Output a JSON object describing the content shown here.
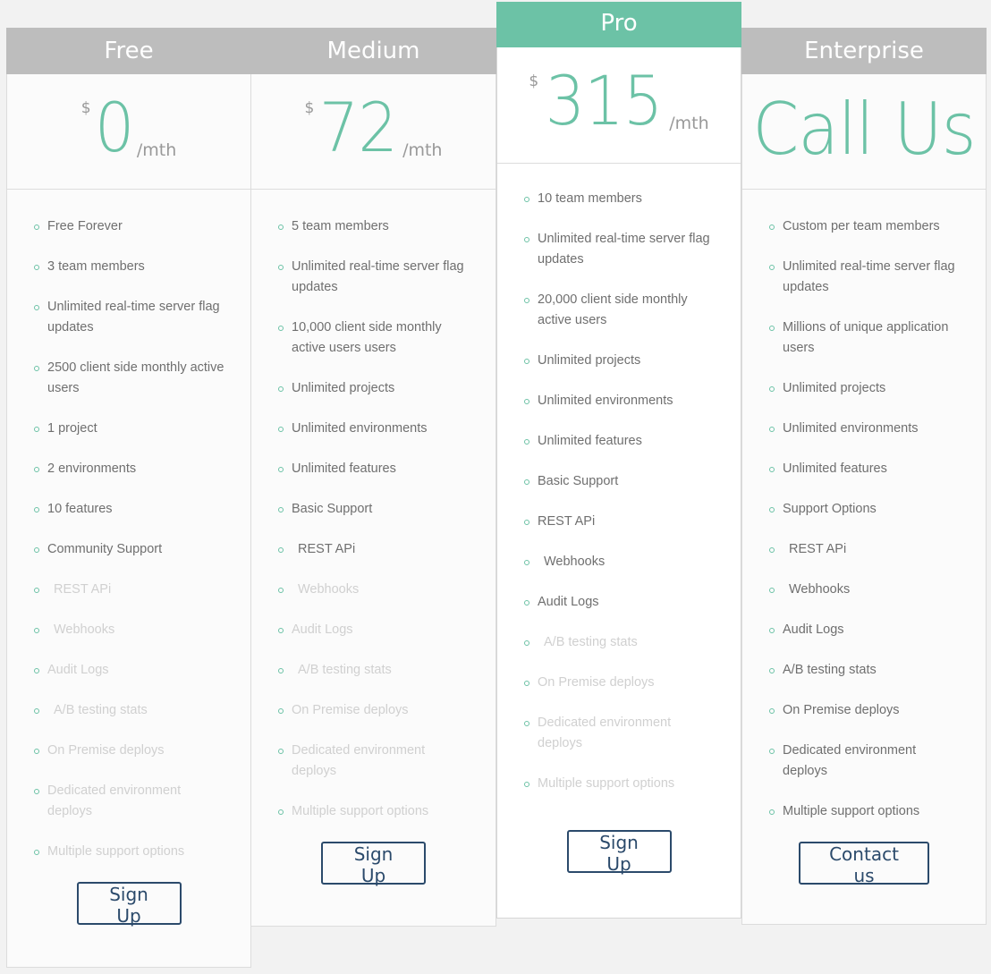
{
  "colors": {
    "accent": "#6cc2a6",
    "header_gray": "#bdbdbd",
    "button_navy": "#2b4a6b",
    "text": "#6f6f6f",
    "text_disabled": "#d0d0d0",
    "background": "#f2f2f2"
  },
  "plans": [
    {
      "name": "Free",
      "currency": "$",
      "price": "0",
      "period": "/mth",
      "featured": false,
      "features": [
        {
          "label": "Free Forever",
          "enabled": true,
          "indent": false
        },
        {
          "label": "3 team members",
          "enabled": true,
          "indent": false
        },
        {
          "label": "Unlimited real-time server flag updates",
          "enabled": true,
          "indent": false
        },
        {
          "label": "2500 client side monthly active users",
          "enabled": true,
          "indent": false
        },
        {
          "label": "1 project",
          "enabled": true,
          "indent": false
        },
        {
          "label": "2 environments",
          "enabled": true,
          "indent": false
        },
        {
          "label": "10 features",
          "enabled": true,
          "indent": false
        },
        {
          "label": "Community Support",
          "enabled": true,
          "indent": false
        },
        {
          "label": "REST APi",
          "enabled": false,
          "indent": true
        },
        {
          "label": "Webhooks",
          "enabled": false,
          "indent": true
        },
        {
          "label": "Audit Logs",
          "enabled": false,
          "indent": false
        },
        {
          "label": "A/B testing stats",
          "enabled": false,
          "indent": true
        },
        {
          "label": "On Premise deploys",
          "enabled": false,
          "indent": false
        },
        {
          "label": "Dedicated environment deploys",
          "enabled": false,
          "indent": false
        },
        {
          "label": "Multiple support options",
          "enabled": false,
          "indent": false
        }
      ],
      "cta": "Sign Up"
    },
    {
      "name": "Medium",
      "currency": "$",
      "price": "72",
      "period": "/mth",
      "featured": false,
      "features": [
        {
          "label": "5 team members",
          "enabled": true,
          "indent": false
        },
        {
          "label": "Unlimited real-time server flag updates",
          "enabled": true,
          "indent": false
        },
        {
          "label": "10,000 client side monthly active users users",
          "enabled": true,
          "indent": false
        },
        {
          "label": "Unlimited projects",
          "enabled": true,
          "indent": false
        },
        {
          "label": "Unlimited environments",
          "enabled": true,
          "indent": false
        },
        {
          "label": "Unlimited features",
          "enabled": true,
          "indent": false
        },
        {
          "label": "Basic Support",
          "enabled": true,
          "indent": false
        },
        {
          "label": "REST APi",
          "enabled": true,
          "indent": true
        },
        {
          "label": "Webhooks",
          "enabled": false,
          "indent": true
        },
        {
          "label": "Audit Logs",
          "enabled": false,
          "indent": false
        },
        {
          "label": "A/B testing stats",
          "enabled": false,
          "indent": true
        },
        {
          "label": "On Premise deploys",
          "enabled": false,
          "indent": false
        },
        {
          "label": "Dedicated environment deploys",
          "enabled": false,
          "indent": false
        },
        {
          "label": "Multiple support options",
          "enabled": false,
          "indent": false
        }
      ],
      "cta": "Sign Up"
    },
    {
      "name": "Pro",
      "currency": "$",
      "price": "315",
      "period": "/mth",
      "featured": true,
      "features": [
        {
          "label": "10 team members",
          "enabled": true,
          "indent": false
        },
        {
          "label": "Unlimited real-time server flag updates",
          "enabled": true,
          "indent": false
        },
        {
          "label": "20,000 client side monthly active users",
          "enabled": true,
          "indent": false
        },
        {
          "label": "Unlimited projects",
          "enabled": true,
          "indent": false
        },
        {
          "label": "Unlimited environments",
          "enabled": true,
          "indent": false
        },
        {
          "label": "Unlimited features",
          "enabled": true,
          "indent": false
        },
        {
          "label": "Basic Support",
          "enabled": true,
          "indent": false
        },
        {
          "label": "REST APi",
          "enabled": true,
          "indent": false
        },
        {
          "label": "Webhooks",
          "enabled": true,
          "indent": true
        },
        {
          "label": "Audit Logs",
          "enabled": true,
          "indent": false
        },
        {
          "label": "A/B testing stats",
          "enabled": false,
          "indent": true
        },
        {
          "label": "On Premise deploys",
          "enabled": false,
          "indent": false
        },
        {
          "label": "Dedicated environment deploys",
          "enabled": false,
          "indent": false
        },
        {
          "label": "Multiple support options",
          "enabled": false,
          "indent": false
        }
      ],
      "cta": "Sign Up"
    },
    {
      "name": "Enterprise",
      "price_text": "Call Us",
      "featured": false,
      "features": [
        {
          "label": "Custom per team members",
          "enabled": true,
          "indent": false
        },
        {
          "label": "Unlimited real-time server flag updates",
          "enabled": true,
          "indent": false
        },
        {
          "label": "Millions of unique application users",
          "enabled": true,
          "indent": false
        },
        {
          "label": "Unlimited projects",
          "enabled": true,
          "indent": false
        },
        {
          "label": "Unlimited environments",
          "enabled": true,
          "indent": false
        },
        {
          "label": "Unlimited features",
          "enabled": true,
          "indent": false
        },
        {
          "label": "Support Options",
          "enabled": true,
          "indent": false
        },
        {
          "label": "REST APi",
          "enabled": true,
          "indent": true
        },
        {
          "label": "Webhooks",
          "enabled": true,
          "indent": true
        },
        {
          "label": "Audit Logs",
          "enabled": true,
          "indent": false
        },
        {
          "label": "A/B testing stats",
          "enabled": true,
          "indent": false
        },
        {
          "label": "On Premise deploys",
          "enabled": true,
          "indent": false
        },
        {
          "label": "Dedicated environment deploys",
          "enabled": true,
          "indent": false
        },
        {
          "label": "Multiple support options",
          "enabled": true,
          "indent": false
        }
      ],
      "cta": "Contact us"
    }
  ]
}
